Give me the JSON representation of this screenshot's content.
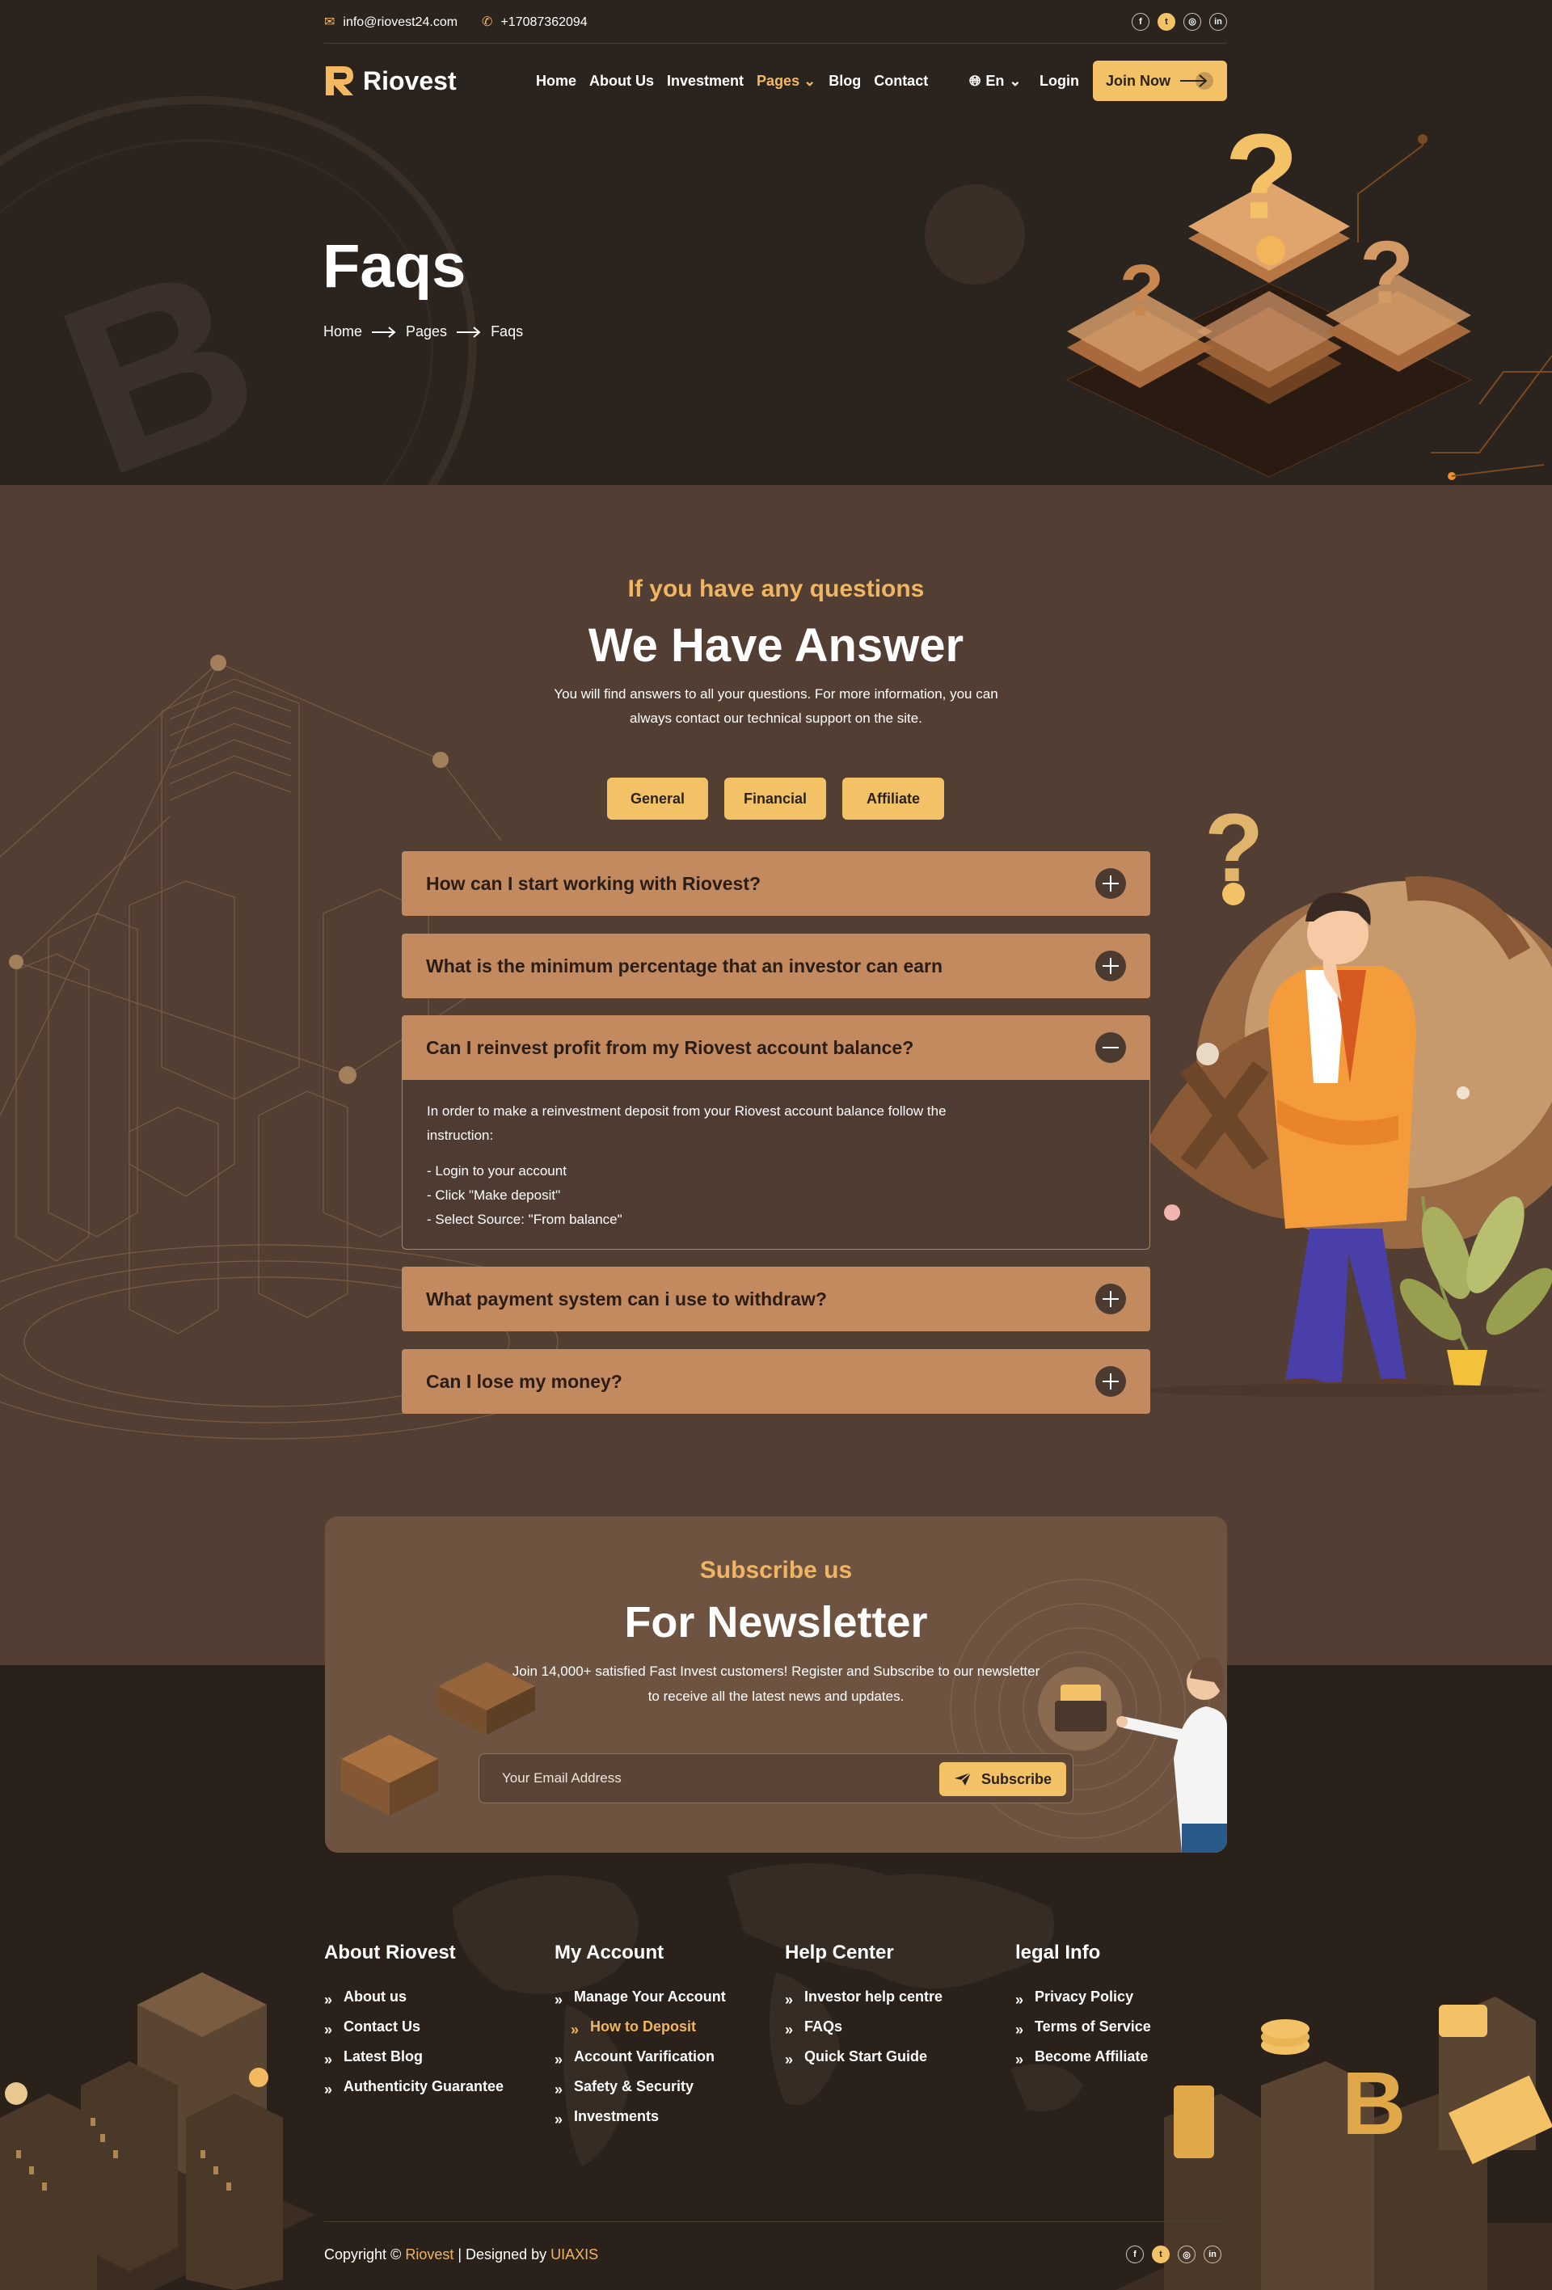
{
  "topbar": {
    "email": "info@riovest24.com",
    "phone": "+17087362094",
    "socials": [
      "f",
      "t",
      "ig",
      "in"
    ]
  },
  "nav": {
    "logo": "Riovest",
    "items": [
      "Home",
      "About Us",
      "Investment",
      "Pages",
      "Blog",
      "Contact"
    ],
    "language": "En",
    "login": "Login",
    "join": "Join Now"
  },
  "hero": {
    "title": "Faqs",
    "breadcrumb": [
      "Home",
      "Pages",
      "Faqs"
    ]
  },
  "faq": {
    "subtitle": "If you have any questions",
    "title": "We Have Answer",
    "description": "You will find answers to all your questions. For more information, you can always contact our technical support on the site.",
    "tabs": [
      "General",
      "Financial",
      "Affiliate"
    ],
    "items": [
      {
        "question": "How can I start working with Riovest?"
      },
      {
        "question": "What is the minimum percentage that an investor can earn"
      },
      {
        "question": "Can I reinvest profit from my Riovest account balance?"
      },
      {
        "question": "What payment system can i use to withdraw?"
      },
      {
        "question": "Can I lose my money?"
      }
    ],
    "open_answer": {
      "intro": "In order to make a reinvestment deposit from your Riovest account balance follow the instruction:",
      "steps": [
        "- Login to your account",
        "- Click \"Make deposit\"",
        "- Select Source: \"From balance\""
      ]
    }
  },
  "newsletter": {
    "subtitle": "Subscribe us",
    "title": "For Newsletter",
    "description": "Join 14,000+ satisfied Fast Invest customers! Register and Subscribe to our newsletter to receive all the latest news and updates.",
    "placeholder": "Your Email Address",
    "button": "Subscribe"
  },
  "footer": {
    "columns": [
      {
        "title": "About Riovest",
        "links": [
          "About us",
          "Contact Us",
          "Latest Blog",
          "Authenticity Guarantee"
        ]
      },
      {
        "title": "My Account",
        "links": [
          "Manage Your Account",
          "How to Deposit",
          "Account Varification",
          "Safety & Security",
          "Investments"
        ]
      },
      {
        "title": "Help Center",
        "links": [
          "Investor help centre",
          "FAQs",
          "Quick Start Guide"
        ]
      },
      {
        "title": "legal Info",
        "links": [
          "Privacy Policy",
          "Terms of Service",
          "Become Affiliate"
        ]
      }
    ],
    "copyright_prefix": "Copyright ©",
    "brand": "Riovest",
    "designed_by": "| Designed by",
    "designer": "UIAXIS"
  },
  "colors": {
    "accent": "#f4c266",
    "accent_text": "#f0b562",
    "hero_bg": "#2b231d",
    "faq_bg": "#523e33",
    "accordion": "#c38a60"
  }
}
